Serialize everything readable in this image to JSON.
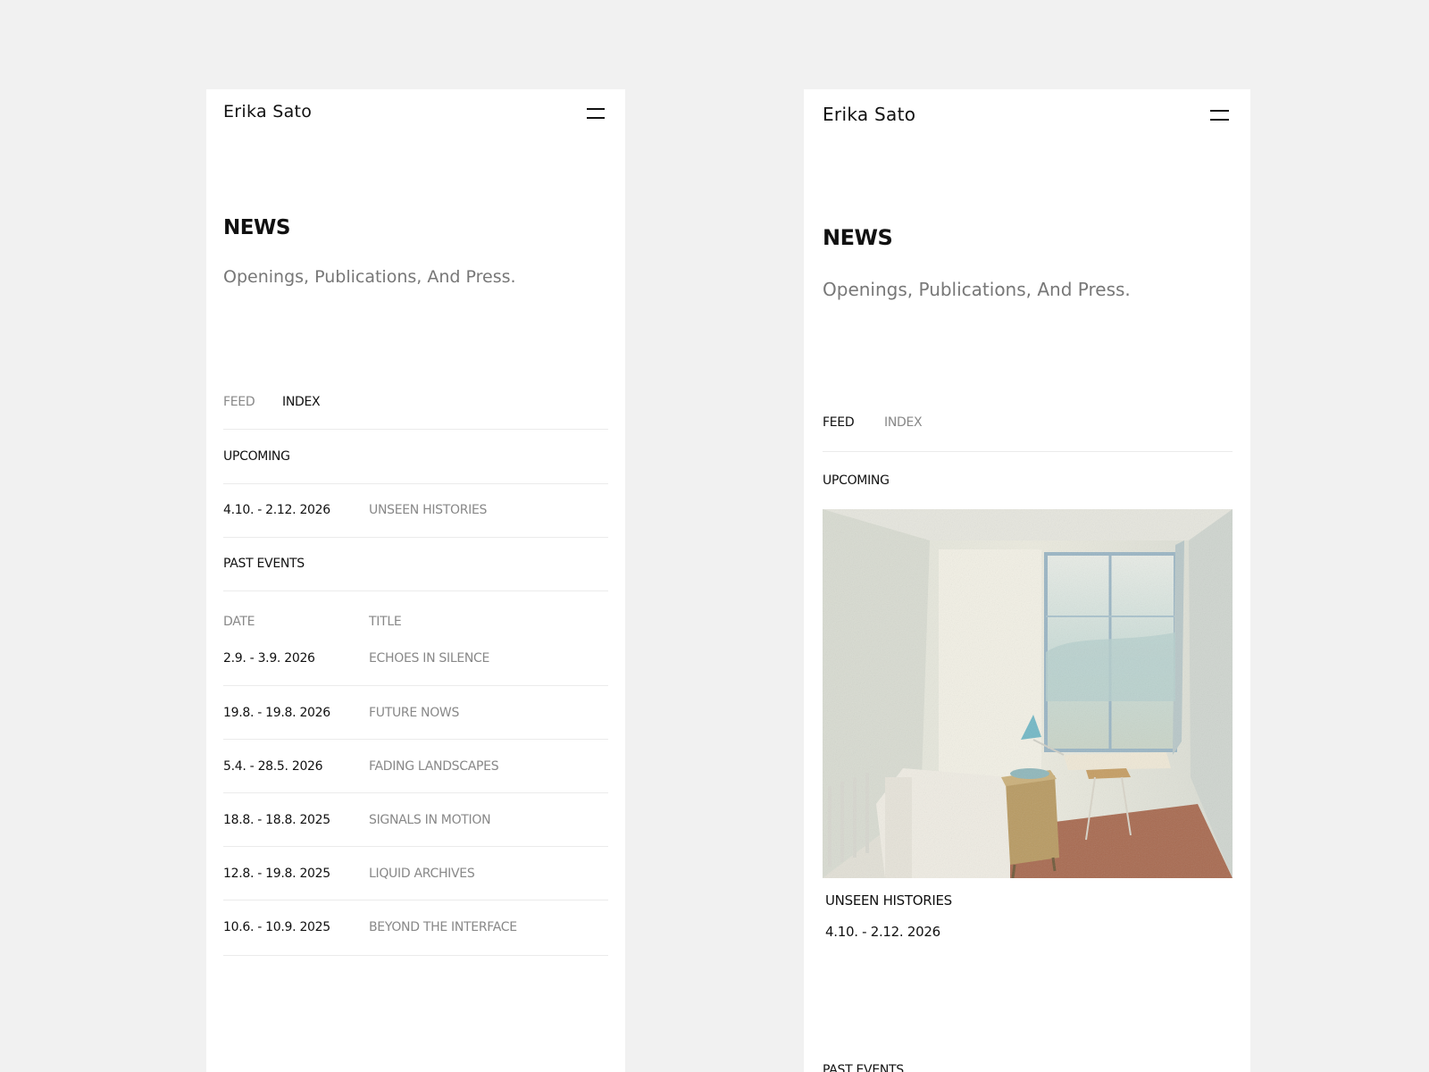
{
  "brand": "Erika Sato",
  "page_title": "NEWS",
  "page_subtitle": "Openings, Publications, And Press.",
  "tabs": {
    "feed": "FEED",
    "index": "INDEX"
  },
  "left": {
    "active_tab": "INDEX",
    "upcoming_label": "UPCOMING",
    "upcoming": [
      {
        "date": "4.10. - 2.12. 2026",
        "title": "UNSEEN HISTORIES"
      }
    ],
    "past_label": "PAST EVENTS",
    "columns": {
      "date": "DATE",
      "title": "TITLE"
    },
    "past": [
      {
        "date": "2.9. - 3.9. 2026",
        "title": "ECHOES IN SILENCE"
      },
      {
        "date": "19.8. - 19.8. 2026",
        "title": "FUTURE NOWS"
      },
      {
        "date": "5.4. - 28.5. 2026",
        "title": "FADING LANDSCAPES"
      },
      {
        "date": "18.8. - 18.8. 2025",
        "title": "SIGNALS IN MOTION"
      },
      {
        "date": "12.8. - 19.8. 2025",
        "title": "LIQUID ARCHIVES"
      },
      {
        "date": "10.6. - 10.9. 2025",
        "title": "BEYOND THE INTERFACE"
      }
    ]
  },
  "right": {
    "active_tab": "FEED",
    "upcoming_label": "UPCOMING",
    "feature": {
      "title": "UNSEEN HISTORIES",
      "date": "4.10. - 2.12. 2026",
      "image_icon": "watercolor-room-painting"
    },
    "past_label": "PAST EVENTS"
  },
  "colors": {
    "background": "#f1f1f1",
    "panel": "#ffffff",
    "text": "#111111",
    "muted": "#888888",
    "divider": "#ebebeb"
  }
}
